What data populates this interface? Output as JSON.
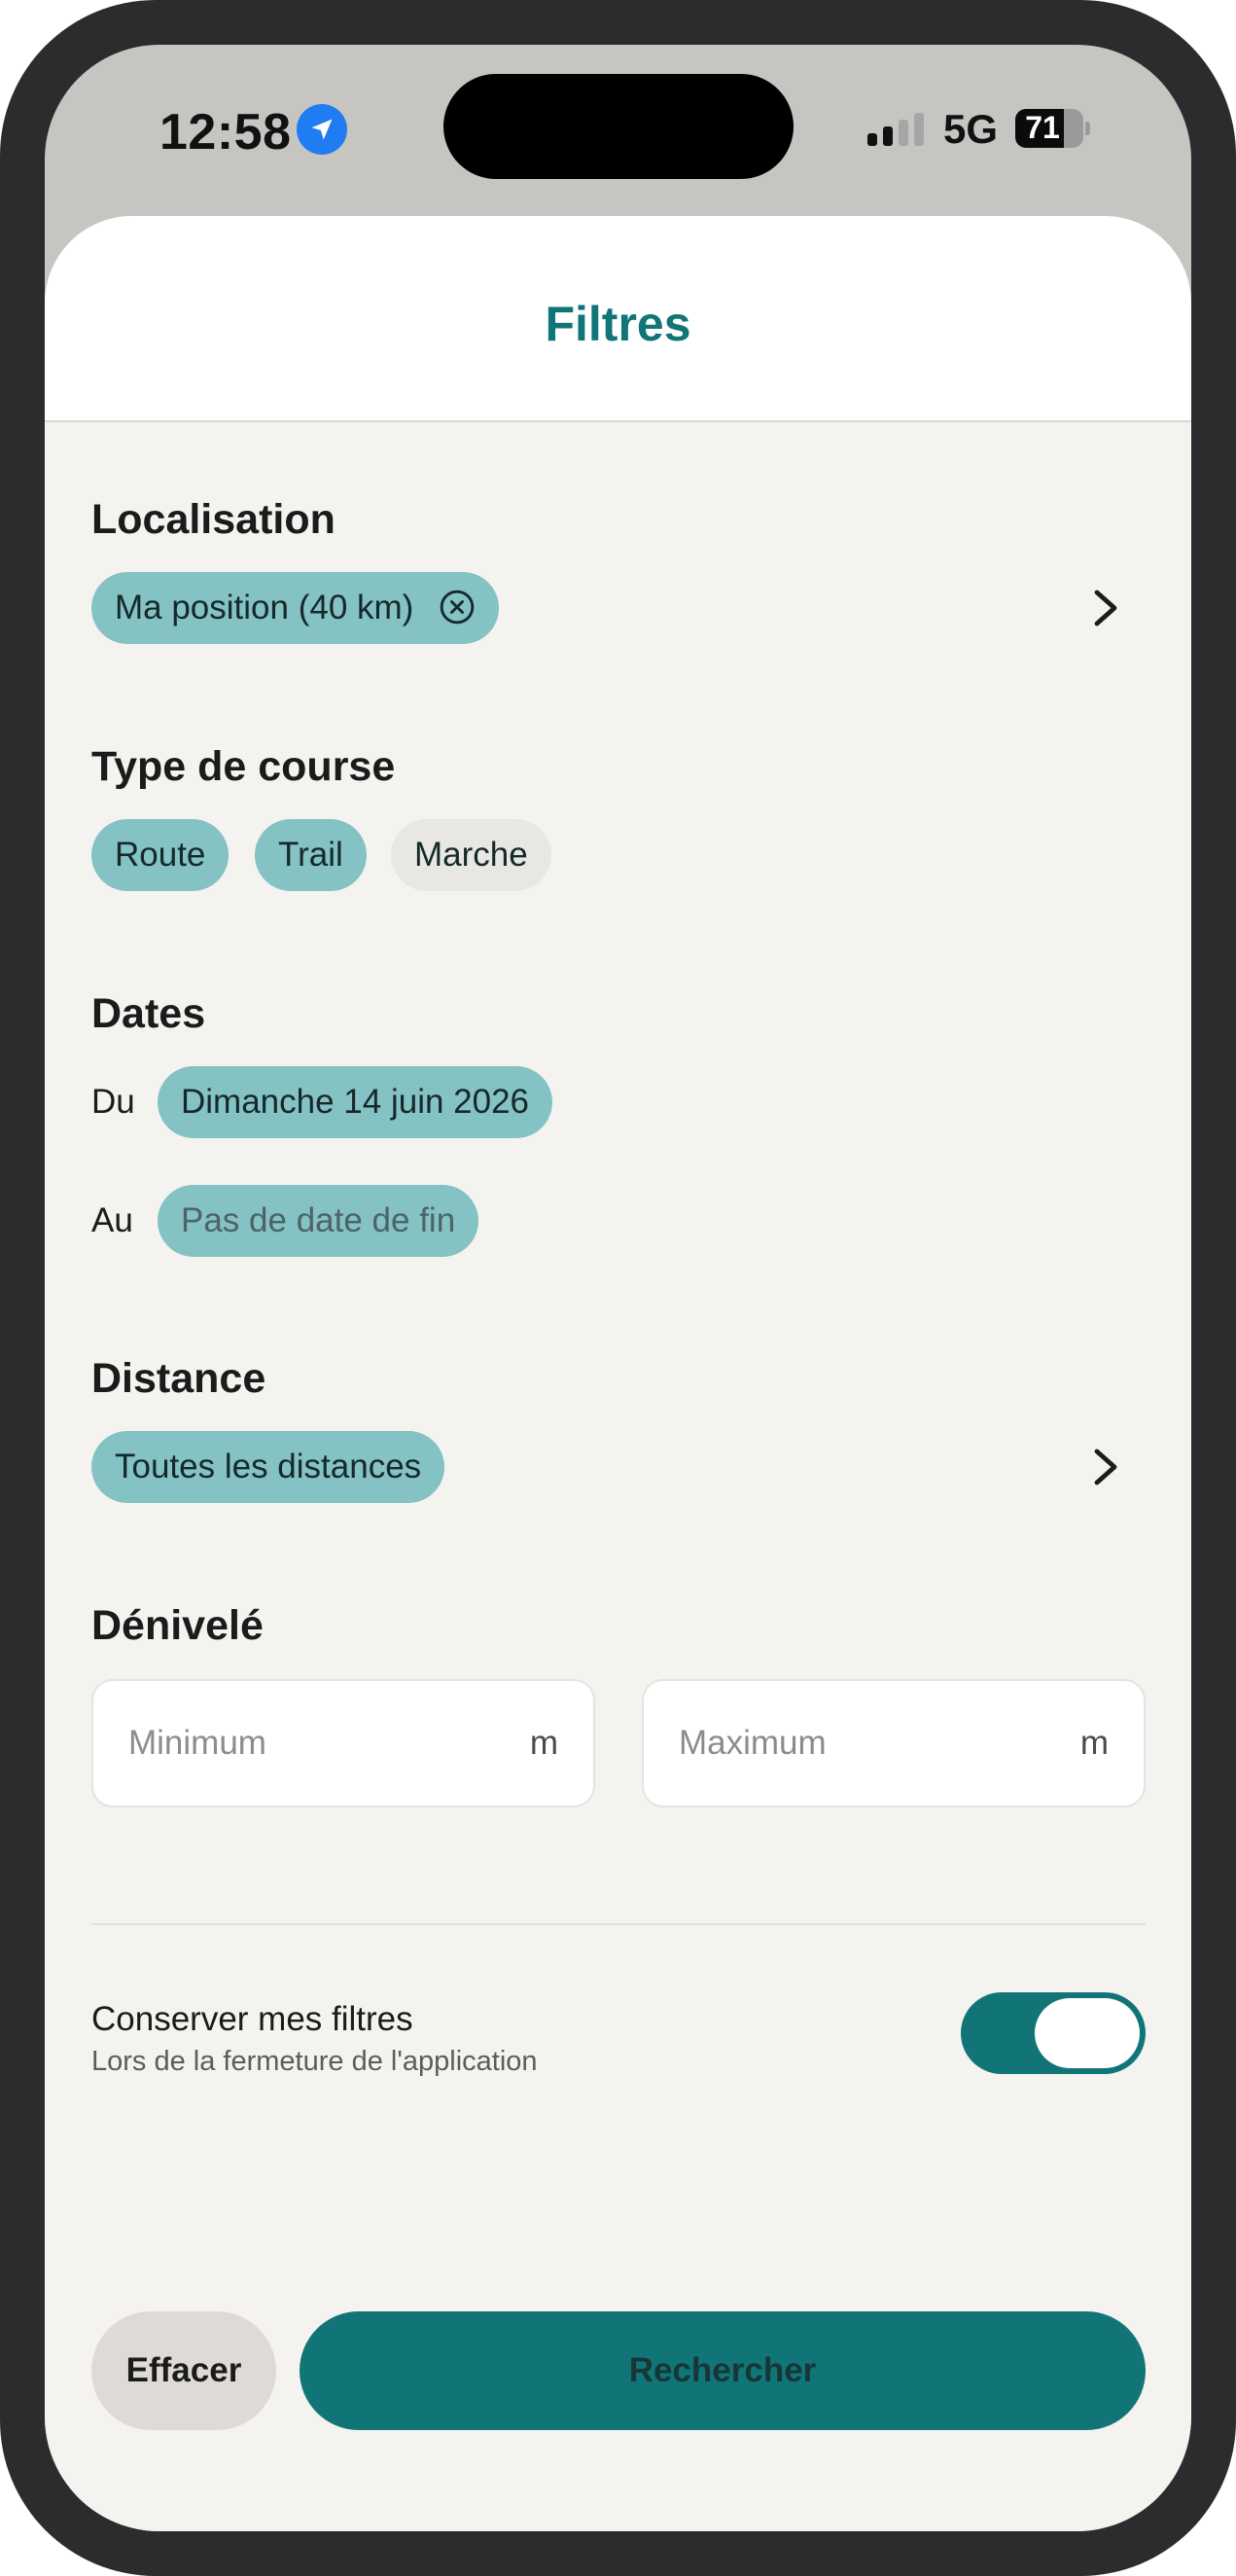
{
  "status_bar": {
    "time": "12:58",
    "network": "5G",
    "battery_percent": "71",
    "battery_level": 0.71,
    "signal_bars_active": 2,
    "signal_bars_total": 4
  },
  "sheet": {
    "title": "Filtres"
  },
  "localisation": {
    "title": "Localisation",
    "chip_label": "Ma position (40 km)"
  },
  "course_type": {
    "title": "Type de course",
    "options": [
      {
        "label": "Route",
        "selected": true
      },
      {
        "label": "Trail",
        "selected": true
      },
      {
        "label": "Marche",
        "selected": false
      }
    ]
  },
  "dates": {
    "title": "Dates",
    "from_label": "Du",
    "from_value": "Dimanche 14 juin 2026",
    "to_label": "Au",
    "to_value": "Pas de date de fin"
  },
  "distance": {
    "title": "Distance",
    "chip_label": "Toutes les distances"
  },
  "elevation": {
    "title": "Dénivelé",
    "min_placeholder": "Minimum",
    "max_placeholder": "Maximum",
    "unit": "m"
  },
  "keep_filters": {
    "title": "Conserver mes filtres",
    "subtitle": "Lors de la fermeture de l'application",
    "enabled": true
  },
  "actions": {
    "clear_label": "Effacer",
    "search_label": "Rechercher"
  },
  "colors": {
    "accent": "#117577",
    "chip_selected": "#84c2c3",
    "chip_unselected": "#e8e7e3",
    "background": "#f4f3f0",
    "location_badge": "#1f7cf2"
  },
  "icons": {
    "location": "location-arrow-icon",
    "clear": "circle-x-icon",
    "chevron": "chevron-right-icon"
  }
}
